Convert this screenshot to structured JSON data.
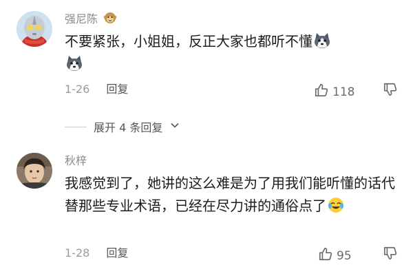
{
  "comments": [
    {
      "username": "强尼陈",
      "text": "不要紧张，小姐姐，反正大家也都听不懂",
      "date": "1-26",
      "reply_label": "回复",
      "likes": "118",
      "avatar_icon": "ultraman-avatar",
      "badge_icon": "monkey-badge-icon",
      "emoji_icon": "husky-emoji-icon"
    },
    {
      "username": "秋梓",
      "text": "我感觉到了，她讲的这么难是为了用我们能听懂的话代替那些专业术语，已经在尽力讲的通俗点了",
      "date": "1-28",
      "reply_label": "回复",
      "likes": "95",
      "avatar_icon": "user-photo-avatar",
      "emoji_icon": "laughing-tears-emoji-icon"
    }
  ],
  "expand_replies": {
    "label": "展开 4 条回复"
  },
  "colors": {
    "text": "#1b1b1b",
    "meta": "#9a9a9a",
    "username": "#8a8a8a"
  }
}
